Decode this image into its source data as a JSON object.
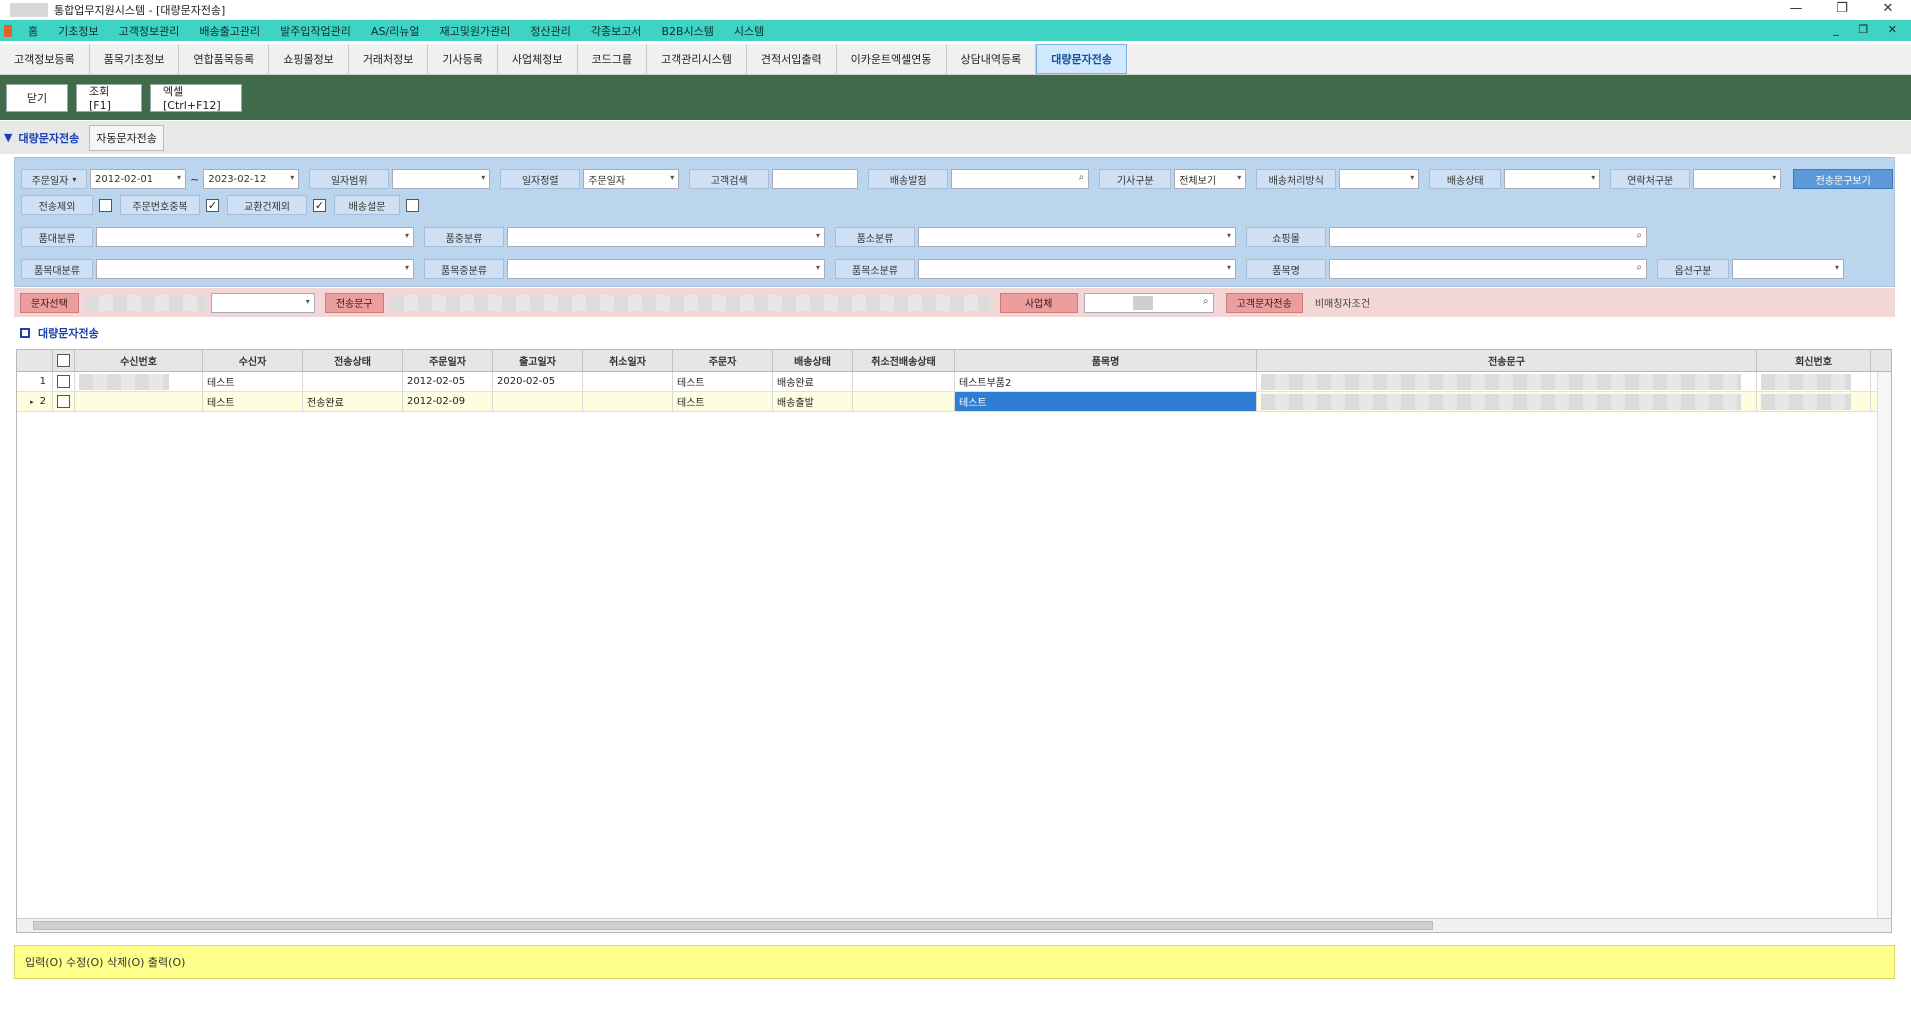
{
  "window": {
    "title": "통합업무지원시스템 - [대량문자전송]",
    "controls": [
      "—",
      "❐",
      "✕"
    ]
  },
  "menu": [
    "홈",
    "기초정보",
    "고객정보관리",
    "배송출고관리",
    "발주입작업관리",
    "AS/리뉴얼",
    "재고및원가관리",
    "정산관리",
    "각종보고서",
    "B2B시스템",
    "시스템"
  ],
  "menu_right": "_ ❐ ✕",
  "tabs": [
    "고객정보등록",
    "품목기초정보",
    "연합품목등록",
    "쇼핑몰정보",
    "거래처정보",
    "기사등록",
    "사업체정보",
    "코드그룹",
    "고객관리시스템",
    "견적서입출력",
    "이카운트엑셀연동",
    "상담내역등록",
    "대량문자전송"
  ],
  "toolbar": {
    "close": "닫기",
    "search": "조회[F1]",
    "excel": "엑셀[Ctrl+F12]"
  },
  "subtabs": {
    "main": "대량문자전송",
    "other": "자동문자전송"
  },
  "filters": {
    "row1": {
      "order_date_label": "주문일자",
      "date_from": "2012-02-01",
      "tilde": "~",
      "date_to": "2023-02-12",
      "date_range_label": "일자범위",
      "date_basis_label": "일자정렬",
      "date_basis_value": "주문일자",
      "customer_search_label": "고객검색",
      "delivery_branch_label": "배송발점",
      "driver_type_label": "기사구분",
      "driver_type_value": "전체보기",
      "delivery_method_label": "배송처리방식",
      "delivery_status_label": "배송상태",
      "contact_type_label": "연락처구분",
      "view_phrase_button": "전송문구보기"
    },
    "row2": {
      "exclude_sent_label": "전송제외",
      "order_no_dup_label": "주문번호중복",
      "exchange_label": "교환건제외",
      "delivery_done_label": "배송설문"
    },
    "row3": {
      "major_cat": "품대분류",
      "middle_cat": "품중분류",
      "minor_cat": "품소분류",
      "mall": "쇼핑몰"
    },
    "row4": {
      "item_major": "품목대분류",
      "item_middle": "품목중분류",
      "item_minor": "품목소분류",
      "item_name": "품목명",
      "option_type": "옵션구분"
    }
  },
  "pinkbar": {
    "select_msg": "문자선택",
    "phrase": "전송문구",
    "company": "사업체",
    "send_customer": "고객문자전송",
    "note": "비매칭자조건"
  },
  "grid": {
    "title": "대량문자전송",
    "columns": [
      "",
      "수신번호",
      "수신자",
      "전송상태",
      "주문일자",
      "출고일자",
      "취소일자",
      "주문자",
      "배송상태",
      "취소전배송상태",
      "품목명",
      "전송문구",
      "회신번호"
    ],
    "rows": [
      {
        "no": "1",
        "receiver": "테스트",
        "send_status": "",
        "order_date": "2012-02-05",
        "ship_date": "2020-02-05",
        "cancel_date": "",
        "orderer": "테스트",
        "delivery_status": "배송완료",
        "prev_status": "",
        "item": "테스트부품2"
      },
      {
        "no": "2",
        "receiver": "테스트",
        "send_status": "전송완료",
        "order_date": "2012-02-09",
        "ship_date": "",
        "cancel_date": "",
        "orderer": "테스트",
        "delivery_status": "배송출발",
        "prev_status": "",
        "item": "테스트"
      }
    ]
  },
  "status": "입력(O) 수정(O) 삭제(O) 출력(O)"
}
